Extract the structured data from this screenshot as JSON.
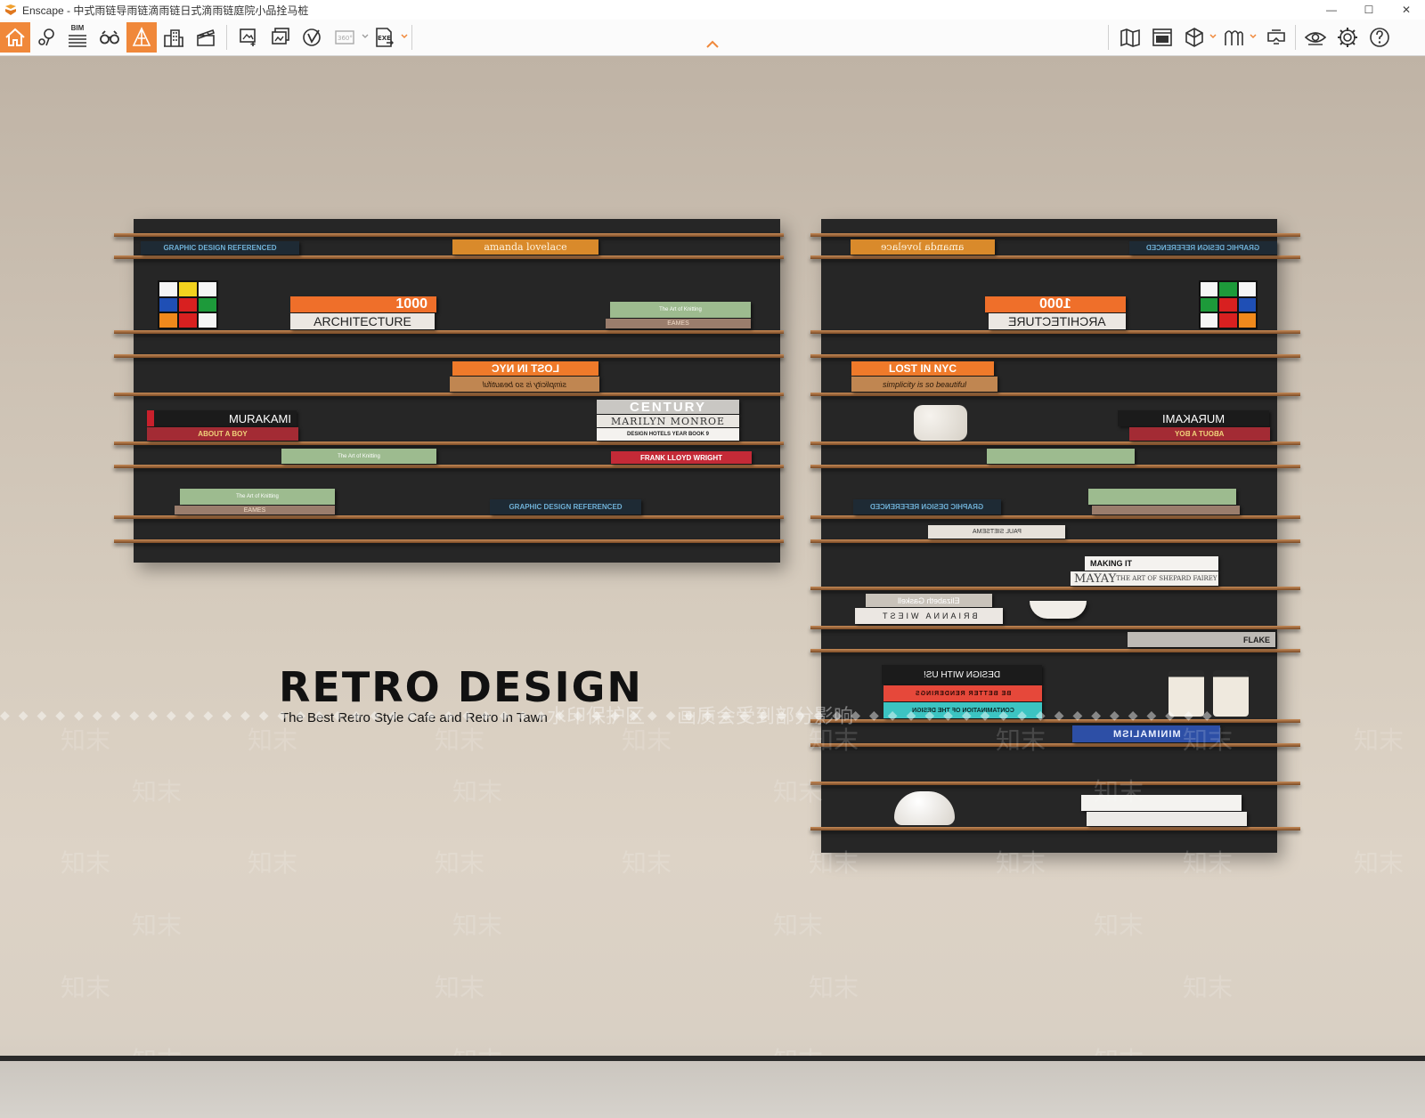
{
  "window": {
    "app_name": "Enscape",
    "separator": " - ",
    "document_title": "中式雨链导雨链滴雨链日式滴雨链庭院小品拴马桩",
    "controls": {
      "minimize": "—",
      "maximize": "☐",
      "close": "✕"
    }
  },
  "toolbar": {
    "bim_label": "BIM",
    "panorama_label": "360°",
    "exe_label": "EXE",
    "left_buttons": [
      "home-icon",
      "location-pin-icon",
      "bim-list-icon",
      "binoculars-icon",
      "perspective-icon",
      "buildings-icon",
      "clapperboard-icon",
      "screenshot-icon",
      "batch-render-icon",
      "web-standalone-icon",
      "panorama-icon",
      "export-exe-icon"
    ],
    "right_buttons": [
      "map-icon",
      "asset-library-icon",
      "material-cube-icon",
      "atmosphere-icon",
      "vr-headset-icon",
      "visual-settings-eye-icon",
      "settings-gear-icon",
      "help-icon"
    ],
    "active_buttons": [
      "home",
      "perspective"
    ],
    "accent_color": "#f0883a"
  },
  "scene": {
    "headline": "RETRO DESIGN",
    "tagline": "The Best Retro Style Cafe and Retro In Tawn",
    "watermark_primary": "水印保护区",
    "watermark_secondary": "画质会受到部分影响",
    "watermark_brand": "知末",
    "left_shelf_books": [
      "GRAPHIC DESIGN REFERENCED",
      "amanda lovelace",
      "1000",
      "ARCHITECTURE",
      "The Art of Knitting",
      "EAMES",
      "LOST IN NYC",
      "simplicity is so beautiful",
      "MURAKAMI",
      "ABOUT A BOY",
      "CENTURY",
      "MARILYN MONROE",
      "DESIGN HOTELS YEAR BOOK 9",
      "FRANK LLOYD WRIGHT"
    ],
    "right_shelf_books": [
      "amanda lovelace",
      "GRAPHIC DESIGN REFERENCED",
      "1000",
      "ARCHITECTURE",
      "LOST IN NYC",
      "simplicity is so beautiful",
      "MURAKAMI",
      "ABOUT A BOY",
      "PAUL SIETSEMA",
      "MAKING IT",
      "MAYAY",
      "THE ART OF SHEPARD FAIREY",
      "Elizabeth Gaskell",
      "BRIANNA WIEST",
      "FLAKE",
      "DESIGN WITH US!",
      "BE BETTER RENDERINGS",
      "CONTAMINATION OF THE DESIGN",
      "MINIMALISM"
    ]
  }
}
